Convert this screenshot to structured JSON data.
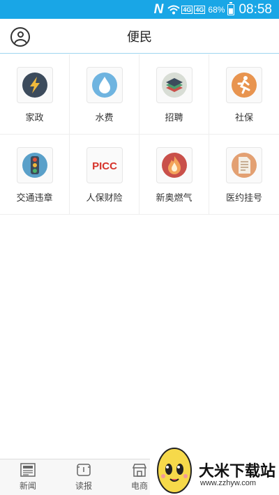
{
  "status_bar": {
    "carrier_glyph": "N",
    "signal_1": "4G",
    "signal_2": "4G",
    "battery_pct": "68%",
    "battery_level": 0.68,
    "time": "08:58"
  },
  "header": {
    "title": "便民",
    "avatar_icon": "user-icon"
  },
  "services": [
    {
      "label": "家政",
      "icon": "lightning-icon",
      "color": "#3c4b5c"
    },
    {
      "label": "水费",
      "icon": "water-drop-icon",
      "color": "#6fb4e0"
    },
    {
      "label": "招聘",
      "icon": "stack-layers-icon",
      "color": "#d8ddd5"
    },
    {
      "label": "社保",
      "icon": "running-person-icon",
      "color": "#e8944f"
    },
    {
      "label": "交通违章",
      "icon": "traffic-light-icon",
      "color": "#5aa0c9"
    },
    {
      "label": "人保财险",
      "icon": "picc-logo-icon",
      "color": "#d6322a",
      "logo_text": "PICC"
    },
    {
      "label": "新奥燃气",
      "icon": "flame-icon",
      "color": "#c9504a"
    },
    {
      "label": "医约挂号",
      "icon": "document-icon",
      "color": "#e3a072"
    }
  ],
  "tabs": [
    {
      "label": "新闻",
      "icon": "newspaper-icon"
    },
    {
      "label": "读报",
      "icon": "reader-icon"
    },
    {
      "label": "电商",
      "icon": "store-icon"
    }
  ],
  "watermark": {
    "text": "大米下载站",
    "url": "www.zzhyw.com"
  }
}
